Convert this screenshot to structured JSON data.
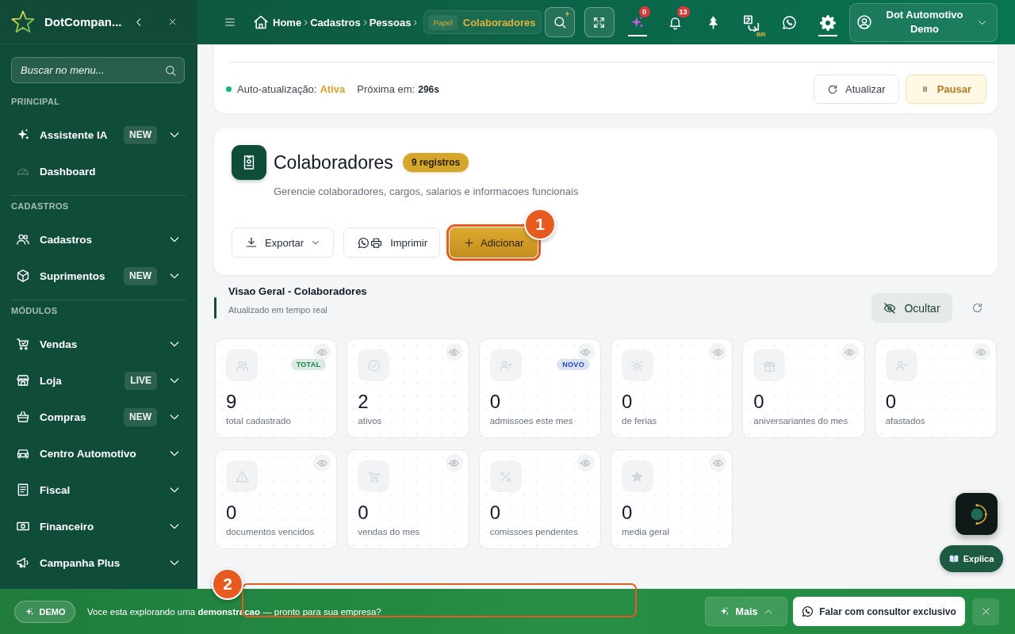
{
  "sidebar": {
    "brand": "DotCompan...",
    "search": {
      "placeholder": "Buscar no menu..."
    },
    "sections": [
      {
        "title": "PRINCIPAL",
        "items": [
          {
            "label": "Assistente IA",
            "badge": "NEW",
            "expandable": true
          },
          {
            "label": "Dashboard",
            "expandable": false
          }
        ]
      },
      {
        "title": "CADASTROS",
        "items": [
          {
            "label": "Cadastros",
            "expandable": true
          },
          {
            "label": "Suprimentos",
            "badge": "NEW",
            "expandable": true
          }
        ]
      },
      {
        "title": "MÓDULOS",
        "items": [
          {
            "label": "Vendas",
            "expandable": true
          },
          {
            "label": "Loja",
            "badge": "LIVE",
            "expandable": true
          },
          {
            "label": "Compras",
            "badge": "NEW",
            "expandable": true
          },
          {
            "label": "Centro Automotivo",
            "expandable": true
          },
          {
            "label": "Fiscal",
            "expandable": true
          },
          {
            "label": "Financeiro",
            "expandable": true
          },
          {
            "label": "Campanha Plus",
            "expandable": true
          }
        ]
      }
    ]
  },
  "topbar": {
    "breadcrumb": [
      "Home",
      "Cadastros",
      "Pessoas"
    ],
    "current": {
      "tag": "Papel",
      "label": "Colaboradores"
    },
    "tools": [
      {
        "badge": "0",
        "selected": true
      },
      {
        "badge": "13",
        "selected": false
      },
      {
        "selected": false
      },
      {
        "caption": "BR",
        "selected": false
      },
      {
        "selected": false
      },
      {
        "selected": true
      }
    ],
    "user": {
      "name": "Dot Automotivo Demo"
    }
  },
  "refresh": {
    "label": "Auto-atualização:",
    "status": "Ativa",
    "active": true,
    "next_label": "Próxima em:",
    "next_value": "296s",
    "buttons": [
      {
        "label": "Atualizar",
        "kind": "refresh"
      },
      {
        "label": "Pausar",
        "kind": "pause"
      }
    ]
  },
  "header": {
    "title": "Colaboradores",
    "count": "9 registros",
    "subtitle": "Gerencie colaboradores, cargos, salarios e informacoes funcionais",
    "actions": [
      {
        "label": "Exportar",
        "kind": "export",
        "highlighted": false
      },
      {
        "label": "Imprimir",
        "kind": "print",
        "highlighted": false
      },
      {
        "label": "Adicionar",
        "kind": "add",
        "highlighted": true
      }
    ]
  },
  "overview": {
    "title": "Visao Geral - Colaboradores",
    "subtitle": "Atualizado em tempo real",
    "toggle": "Ocultar",
    "stats": [
      {
        "value": "9",
        "label": "total cadastrado",
        "badge": {
          "text": "TOTAL",
          "color": "#15804a"
        }
      },
      {
        "value": "2",
        "label": "ativos"
      },
      {
        "value": "0",
        "label": "admissoes este mes",
        "badge": {
          "text": "NOVO",
          "color": "#2448b0"
        }
      },
      {
        "value": "0",
        "label": "de ferias"
      },
      {
        "value": "0",
        "label": "aniversariantes do mes"
      },
      {
        "value": "0",
        "label": "afastados"
      },
      {
        "value": "0",
        "label": "documentos vencidos"
      },
      {
        "value": "0",
        "label": "vendas do mes"
      },
      {
        "value": "0",
        "label": "comissoes pendentes"
      },
      {
        "value": "0",
        "label": "media geral"
      }
    ]
  },
  "assistant": {
    "label": "Explica"
  },
  "demo_bar": {
    "tag": "DEMO",
    "message": "Voce esta explorando uma **demonstracao** — pronto para sua empresa?",
    "more": "Mais",
    "cta": "Falar com consultor exclusivo"
  },
  "callouts": [
    {
      "number": "1"
    },
    {
      "number": "2"
    }
  ]
}
